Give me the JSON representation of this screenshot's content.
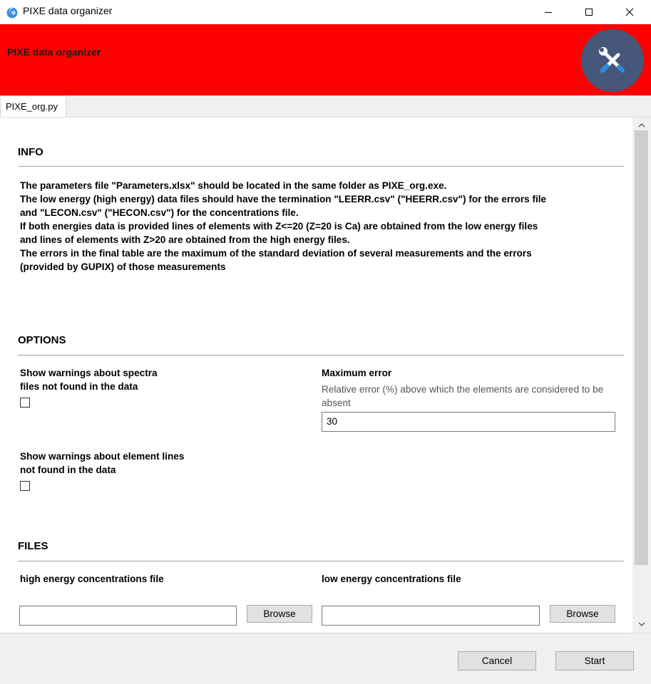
{
  "window": {
    "title": "PIXE data organizer",
    "minimize_icon": "minimize-icon",
    "maximize_icon": "maximize-icon",
    "close_icon": "close-icon"
  },
  "header": {
    "title": "PIXE data organizer",
    "background": "#ff0000",
    "icon": "tools-icon",
    "icon_circle_color": "#46577a"
  },
  "tabs": [
    {
      "label": "PIXE_org.py",
      "selected": true
    }
  ],
  "info": {
    "title": "INFO",
    "lines": [
      "The parameters file \"Parameters.xlsx\" should be located in the same folder as PIXE_org.exe.",
      "The low energy (high energy) data files should have the termination \"LEERR.csv\" (\"HEERR.csv\") for the errors file",
      "and \"LECON.csv\" (\"HECON.csv\") for the concentrations file.",
      "If both energies data is provided lines of elements with Z<=20 (Z=20 is Ca) are obtained from the low energy files",
      "and lines of elements with Z>20 are obtained from the high energy files.",
      "The errors in the final table are the maximum of the standard deviation of several measurements and the errors",
      "(provided by GUPIX) of those measurements"
    ]
  },
  "options": {
    "title": "OPTIONS",
    "spectra_warning": {
      "line1": "Show warnings about spectra",
      "line2": "files not found in the data",
      "checked": false
    },
    "element_warning": {
      "line1": "Show warnings about element lines",
      "line2": "not found in the data",
      "checked": false
    },
    "max_error": {
      "label": "Maximum error",
      "description": "Relative error (%) above which the elements are considered to be absent",
      "value": "30"
    }
  },
  "files": {
    "title": "FILES",
    "high_energy": {
      "label": "high energy concentrations file",
      "value": "",
      "browse": "Browse"
    },
    "low_energy": {
      "label": "low energy concentrations file",
      "value": "",
      "browse": "Browse"
    }
  },
  "footer": {
    "cancel": "Cancel",
    "start": "Start"
  }
}
